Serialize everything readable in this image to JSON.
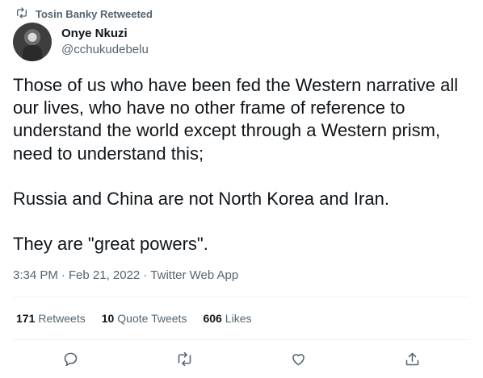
{
  "retweet_context": {
    "icon": "retweet-icon",
    "text": "Tosin Banky Retweeted"
  },
  "author": {
    "name": "Onye Nkuzi",
    "handle": "@cchukudebelu",
    "avatar": "avatar"
  },
  "tweet": {
    "paragraphs": [
      "Those of us who have been fed the Western narrative all our lives, who have no other frame of reference to understand the world except through a Western prism, need to understand this;",
      "Russia and China are not North Korea and Iran.",
      "They are \"great powers\"."
    ],
    "time": "3:34 PM",
    "date": "Feb 21, 2022",
    "source": "Twitter Web App",
    "separator": "·"
  },
  "stats": {
    "retweets": {
      "count": "171",
      "label": "Retweets"
    },
    "quote_tweets": {
      "count": "10",
      "label": "Quote Tweets"
    },
    "likes": {
      "count": "606",
      "label": "Likes"
    }
  },
  "actions": [
    "reply-icon",
    "retweet-icon",
    "like-icon",
    "share-icon"
  ],
  "colors": {
    "text": "#0f1419",
    "secondary": "#536471",
    "divider": "#eff3f4"
  }
}
